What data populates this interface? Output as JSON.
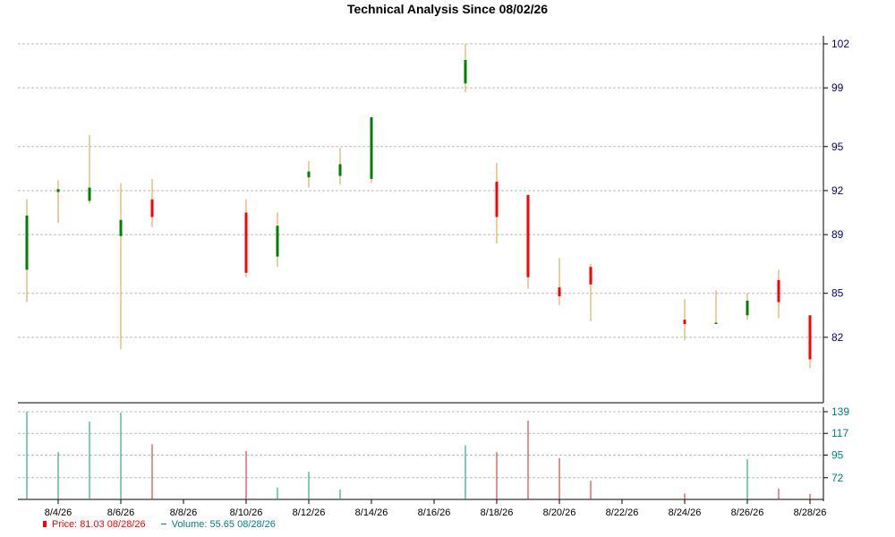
{
  "chart_data": {
    "type": "candlestick",
    "title": "Technical Analysis Since 08/02/26",
    "x_tick_labels": [
      "8/4/26",
      "8/6/26",
      "8/8/26",
      "8/10/26",
      "8/12/26",
      "8/14/26",
      "8/16/26",
      "8/18/26",
      "8/20/26",
      "8/22/26",
      "8/24/26",
      "8/26/26",
      "8/28/26"
    ],
    "price_axis": {
      "ticks": [
        82,
        85,
        89,
        92,
        95,
        99,
        102
      ],
      "range": [
        79.3,
        102.6
      ]
    },
    "volume_axis": {
      "ticks": [
        72,
        95,
        117,
        139
      ],
      "range": [
        50,
        139
      ]
    },
    "grid": true,
    "colors": {
      "up": "#008000",
      "down": "#ff0000",
      "wick": "#d4a041",
      "price_axis_text": "#000080",
      "volume_axis_text": "#008080",
      "grid": "#bbbbbb",
      "volume_up": "#00a060",
      "volume_down": "#cc2222"
    },
    "candles": [
      {
        "date": "8/3/26",
        "open": 86.6,
        "high": 91.4,
        "low": 84.4,
        "close": 90.3,
        "volume": 139
      },
      {
        "date": "8/4/26",
        "open": 91.9,
        "high": 92.7,
        "low": 89.8,
        "close": 92.1,
        "volume": 98
      },
      {
        "date": "8/5/26",
        "open": 91.3,
        "high": 95.8,
        "low": 91.1,
        "close": 92.2,
        "volume": 129
      },
      {
        "date": "8/6/26",
        "open": 88.9,
        "high": 92.5,
        "low": 81.2,
        "close": 90.0,
        "volume": 138
      },
      {
        "date": "8/7/26",
        "open": 91.4,
        "high": 92.8,
        "low": 89.5,
        "close": 90.2,
        "volume": 106
      },
      {
        "date": "8/10/26",
        "open": 90.5,
        "high": 91.4,
        "low": 86.1,
        "close": 86.4,
        "volume": 99
      },
      {
        "date": "8/11/26",
        "open": 87.5,
        "high": 90.5,
        "low": 86.8,
        "close": 89.6,
        "volume": 62
      },
      {
        "date": "8/12/26",
        "open": 92.9,
        "high": 94.0,
        "low": 92.2,
        "close": 93.3,
        "volume": 78
      },
      {
        "date": "8/13/26",
        "open": 93.0,
        "high": 94.9,
        "low": 92.4,
        "close": 93.8,
        "volume": 60
      },
      {
        "date": "8/14/26",
        "open": 92.8,
        "high": 97.0,
        "low": 92.5,
        "close": 97.0,
        "volume": 50
      },
      {
        "date": "8/17/26",
        "open": 99.3,
        "high": 102.0,
        "low": 98.7,
        "close": 100.9,
        "volume": 105
      },
      {
        "date": "8/18/26",
        "open": 92.6,
        "high": 93.9,
        "low": 88.4,
        "close": 90.2,
        "volume": 98
      },
      {
        "date": "8/19/26",
        "open": 91.7,
        "high": 91.7,
        "low": 85.3,
        "close": 86.1,
        "volume": 130
      },
      {
        "date": "8/20/26",
        "open": 85.4,
        "high": 87.4,
        "low": 84.2,
        "close": 84.8,
        "volume": 92
      },
      {
        "date": "8/21/26",
        "open": 86.8,
        "high": 87.0,
        "low": 83.1,
        "close": 85.6,
        "volume": 69
      },
      {
        "date": "8/24/26",
        "open": 83.2,
        "high": 84.6,
        "low": 81.8,
        "close": 82.9,
        "volume": 56
      },
      {
        "date": "8/25/26",
        "open": 83.0,
        "high": 85.2,
        "low": 83.0,
        "close": 83.0,
        "volume": 50
      },
      {
        "date": "8/26/26",
        "open": 83.5,
        "high": 85.0,
        "low": 83.2,
        "close": 84.5,
        "volume": 91
      },
      {
        "date": "8/27/26",
        "open": 85.9,
        "high": 86.6,
        "low": 83.3,
        "close": 84.4,
        "volume": 61
      },
      {
        "date": "8/28/26",
        "open": 83.5,
        "high": 83.5,
        "low": 79.9,
        "close": 80.5,
        "volume": 55.65
      }
    ],
    "legend": {
      "position": "bottom-left",
      "price": {
        "label": "Price:",
        "value": "81.03",
        "date": "08/28/26",
        "color": "#ff0000"
      },
      "volume": {
        "label": "Volume:",
        "value": "55.65",
        "date": "08/28/26",
        "color": "#008080"
      }
    }
  }
}
